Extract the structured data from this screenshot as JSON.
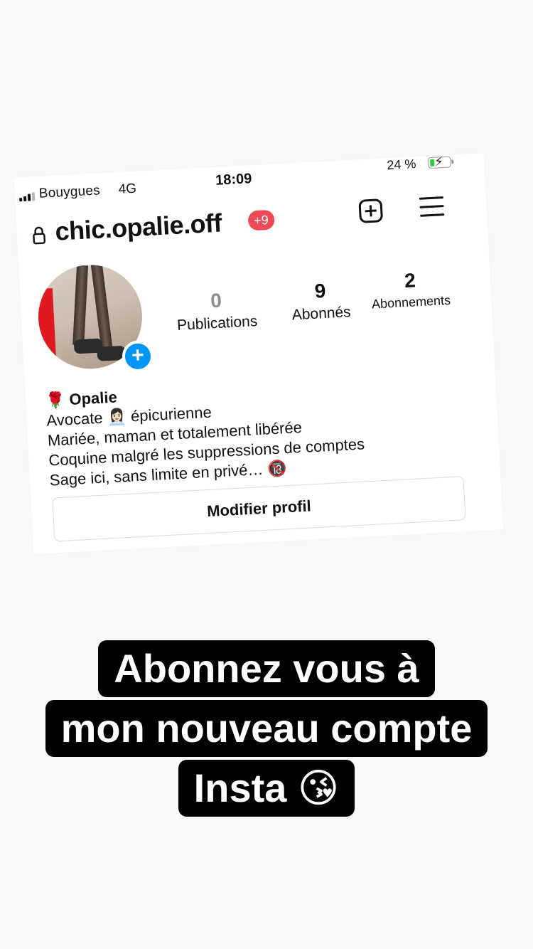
{
  "status_bar": {
    "carrier": "Bouygues",
    "network": "4G",
    "time": "18:09",
    "battery_pct": "24 %",
    "battery_level": 0.24
  },
  "header": {
    "username": "chic.opalie.off",
    "notification_badge": "+9"
  },
  "stats": {
    "publications": {
      "value": "0",
      "label": "Publications"
    },
    "followers": {
      "value": "9",
      "label": "Abonnés"
    },
    "following": {
      "value": "2",
      "label": "Abonnements"
    }
  },
  "bio": {
    "name": "🌹 Opalie",
    "line1": "Avocate 👩🏻‍💼 épicurienne",
    "line2": "Mariée, maman et totalement libérée",
    "line3": "Coquine malgré les suppressions de comptes",
    "line4": "Sage ici, sans limite en privé… 🔞"
  },
  "edit_profile_label": "Modifier profil",
  "caption": {
    "line1": "Abonnez vous à",
    "line2": "mon nouveau compte",
    "line3": "Insta 😘"
  }
}
